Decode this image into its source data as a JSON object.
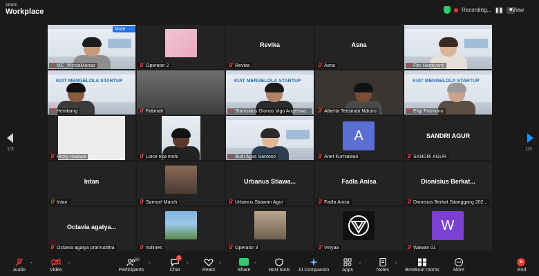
{
  "app": {
    "brand_top": "zoom",
    "brand_bottom": "Workplace"
  },
  "topbar": {
    "recording_label": "Recording...",
    "pause_glyph": "❚❚",
    "stop_glyph": "■",
    "view_label": "View",
    "shield_icon": "security-shield-icon"
  },
  "pagination": {
    "left_label": "1/3",
    "right_label": "1/3"
  },
  "tiles": {
    "t0": {
      "name": "MC_WindaManao",
      "mute_label": "Mute",
      "more_label": "···"
    },
    "t1": {
      "name": "Operator 2"
    },
    "t2": {
      "name": "Revika",
      "big": "Revika"
    },
    "t3": {
      "name": "Asna",
      "big": "Asna"
    },
    "t4": {
      "name": "Fitri Hardiyanti"
    },
    "t5": {
      "name": "Hembang"
    },
    "t6": {
      "name": "Fatimah"
    },
    "t7": {
      "name": "Stanislaus Glorius Vigo Angeswa..."
    },
    "t8": {
      "name": "Alberta Terisman Ndruru"
    },
    "t9": {
      "name": "Eligi Pramono"
    },
    "t10": {
      "name": "Ricky Hiaawa"
    },
    "t11": {
      "name": "Loice rika mofu"
    },
    "t12": {
      "name": "Budi Agus Santoso"
    },
    "t13": {
      "name": "Arief Kurniawan",
      "letter": "A"
    },
    "t14": {
      "name": "SANDRI AGUR",
      "big": "SANDRI AGUR"
    },
    "t15": {
      "name": "Intan",
      "big": "Intan"
    },
    "t16": {
      "name": "Samuel March"
    },
    "t17": {
      "name": "Urbanus Stiawan Agur",
      "big": "Urbanus Stiawa..."
    },
    "t18": {
      "name": "Fadla Anisa",
      "big": "Fadla Anisa"
    },
    "t19": {
      "name": "Dionisius Berkat Sitanggang 202...",
      "big": "Dionisius Berkat..."
    },
    "t20": {
      "name": "Octavia agatya pramuditha",
      "big": "Octavia agatya..."
    },
    "t21": {
      "name": "hollines"
    },
    "t22": {
      "name": "Operator 3"
    },
    "t23": {
      "name": "Viriyaa"
    },
    "t24": {
      "name": "Wawan 01",
      "letter": "W"
    }
  },
  "slide_text": "KIAT MENGELOLA STARTUP",
  "toolbar": {
    "audio": "Audio",
    "video": "Video",
    "participants": "Participants",
    "participants_count": "68",
    "chat": "Chat",
    "chat_badge": "1",
    "react": "React",
    "share": "Share",
    "host_tools": "Host tools",
    "ai_companion": "AI Companion",
    "apps": "Apps",
    "notes": "Notes",
    "breakout_rooms": "Breakout rooms",
    "more": "More",
    "end": "End",
    "end_glyph": "✕"
  },
  "colors": {
    "active_speaker": "#3fbf3f",
    "mute_red": "#e53935",
    "accent_blue": "#1e90ff",
    "share_green": "#2ecc71"
  }
}
